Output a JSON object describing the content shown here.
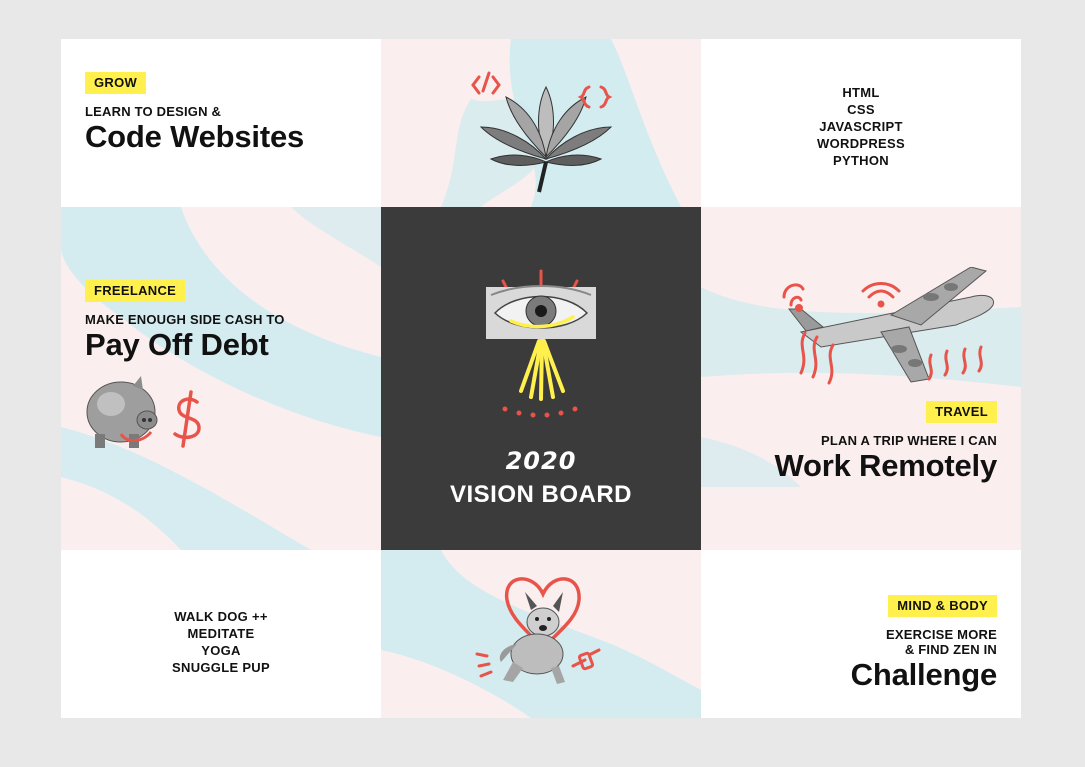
{
  "grow": {
    "tag": "GROW",
    "kicker": "LEARN TO DESIGN &",
    "headline": "Code Websites"
  },
  "skills": {
    "items": [
      "HTML",
      "CSS",
      "JAVASCRIPT",
      "WORDPRESS",
      "PYTHON"
    ]
  },
  "freelance": {
    "tag": "FREELANCE",
    "kicker": "MAKE ENOUGH SIDE CASH TO",
    "headline": "Pay Off Debt"
  },
  "center": {
    "year": "2020",
    "title": "VISION BOARD"
  },
  "travel": {
    "tag": "TRAVEL",
    "kicker": "PLAN A TRIP WHERE I CAN",
    "headline": "Work Remotely"
  },
  "habits": {
    "items": [
      "WALK DOG ++",
      "MEDITATE",
      "YOGA",
      "SNUGGLE PUP"
    ]
  },
  "mind": {
    "tag": "MIND & BODY",
    "kicker_line1": "EXERCISE MORE",
    "kicker_line2": "& FIND ZEN IN",
    "headline": "Challenge"
  },
  "colors": {
    "accent_yellow": "#fff04d",
    "accent_red": "#e8534a",
    "pink_bg": "#fbeeee",
    "blue_stroke": "#cdebf0",
    "dark_panel": "#3b3b3b"
  },
  "icons": [
    "lotus-icon",
    "eye-icon",
    "piggy-bank-icon",
    "dollar-icon",
    "airplane-icon",
    "dog-icon",
    "heart-icon",
    "wifi-icon"
  ]
}
